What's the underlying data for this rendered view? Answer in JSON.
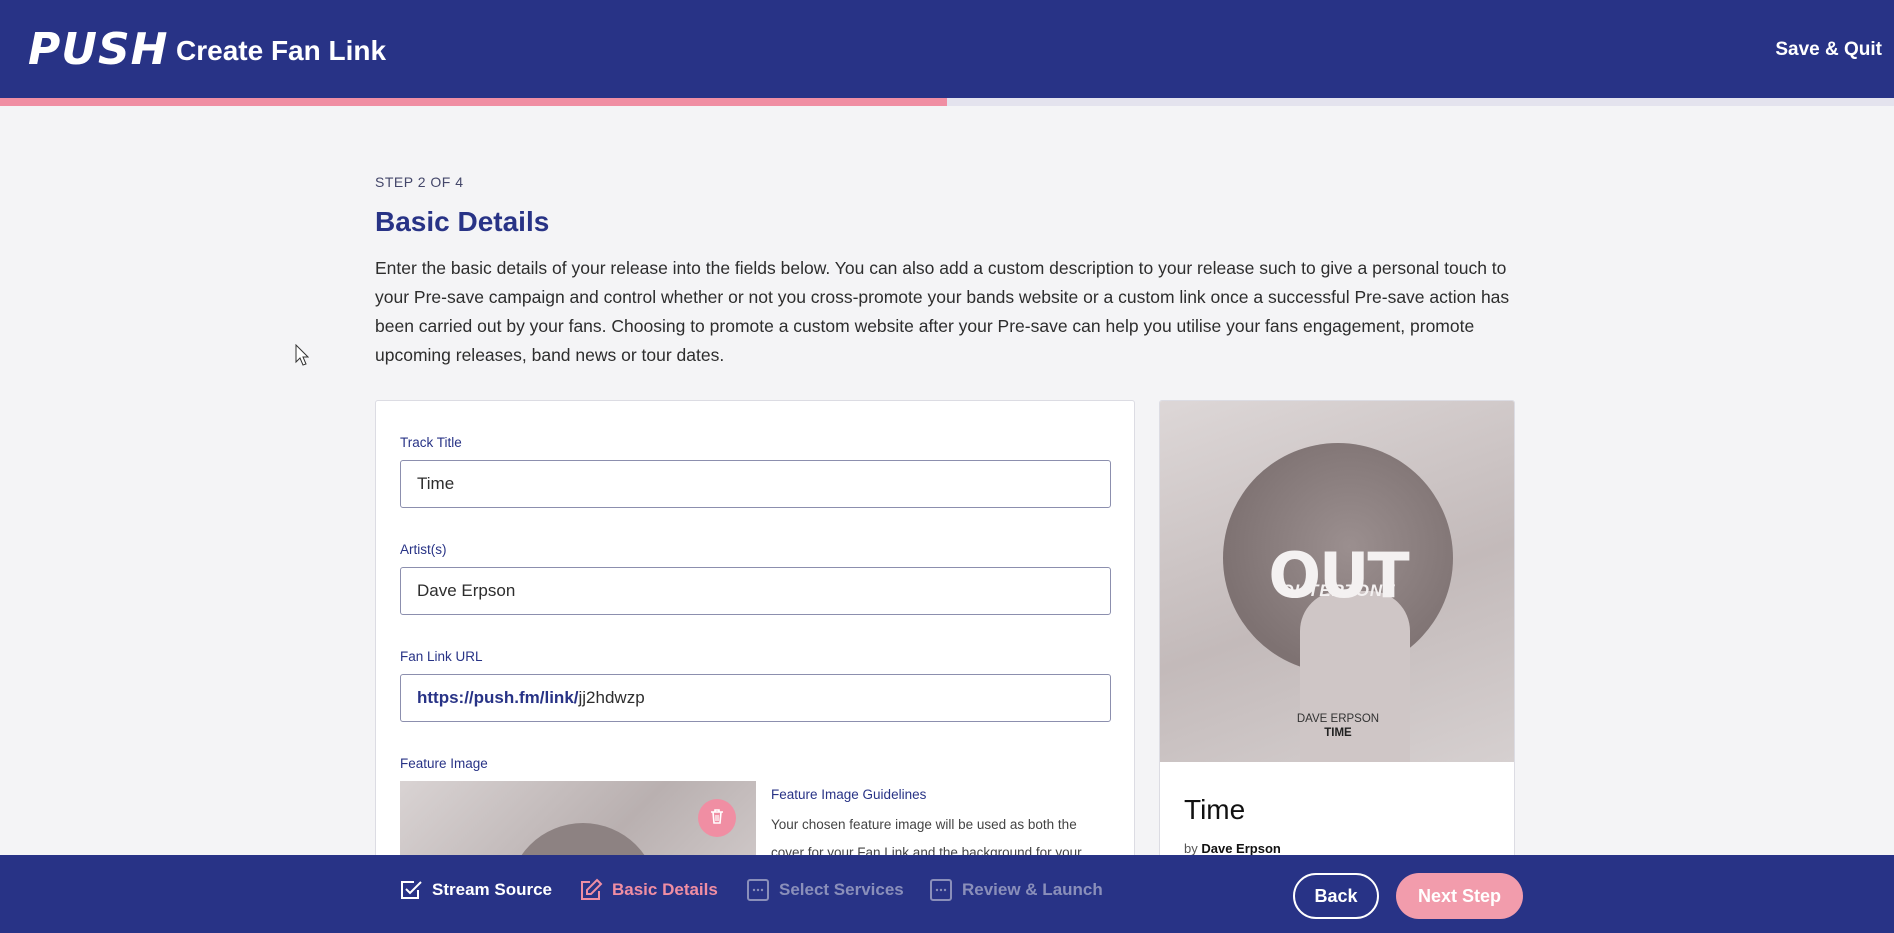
{
  "header": {
    "logo": "PUSH",
    "title": "Create Fan Link",
    "save_quit": "Save & Quit",
    "progress_fraction": 0.5
  },
  "intro": {
    "step_label": "STEP 2 OF 4",
    "title": "Basic Details",
    "description": "Enter the basic details of your release into the fields below. You can also add a custom description to your release such to give a personal touch to your Pre-save campaign and control whether or not you cross-promote your bands website or a custom link once a successful Pre-save action has been carried out by your fans. Choosing to promote a custom website after your Pre-save can help you utilise your fans engagement, promote upcoming releases, band news or tour dates."
  },
  "form": {
    "track_title_label": "Track Title",
    "track_title_value": "Time",
    "artists_label": "Artist(s)",
    "artists_value": "Dave Erpson",
    "fan_link_label": "Fan Link URL",
    "fan_link_prefix": "https://push.fm/link/",
    "fan_link_slug": "jj2hdwzp",
    "feature_image_label": "Feature Image",
    "guidelines_title": "Feature Image Guidelines",
    "guidelines_text": "Your chosen feature image will be used as both the cover for your Fan Link and the background for your"
  },
  "preview": {
    "cover_logo": "OUT",
    "cover_logo_sub": "OUTERTONE",
    "cover_artist": "DAVE ERPSON",
    "cover_track": "TIME",
    "title": "Time",
    "by_label": "by",
    "artist": "Dave Erpson"
  },
  "footer": {
    "steps": [
      {
        "label": "Stream Source",
        "state": "done",
        "icon": "check-square-icon"
      },
      {
        "label": "Basic Details",
        "state": "active",
        "icon": "edit-icon"
      },
      {
        "label": "Select Services",
        "state": "todo",
        "icon": "dots-square-icon"
      },
      {
        "label": "Review & Launch",
        "state": "todo",
        "icon": "dots-square-icon"
      }
    ],
    "back": "Back",
    "next": "Next Step"
  },
  "colors": {
    "brand_navy": "#283386",
    "accent_pink": "#f08ea3",
    "background": "#f4f4f6"
  }
}
